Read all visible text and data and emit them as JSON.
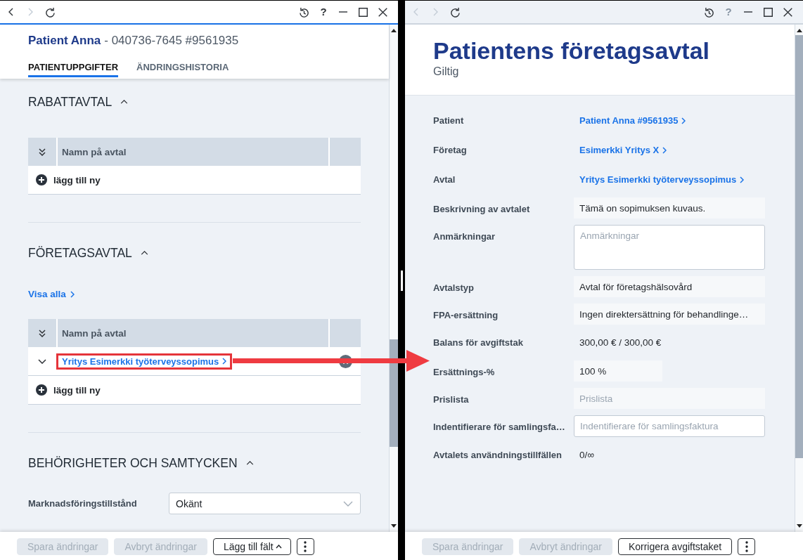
{
  "left_window": {
    "active": true,
    "toolbar": {
      "nav": [
        {
          "kind": "back",
          "disabled": false
        },
        {
          "kind": "forward",
          "disabled": true
        },
        {
          "kind": "reload",
          "disabled": false
        }
      ],
      "actions": [
        {
          "kind": "history",
          "disabled": false
        },
        {
          "kind": "help",
          "label": "?",
          "disabled": false
        },
        {
          "kind": "minimize",
          "disabled": false
        },
        {
          "kind": "maximize",
          "disabled": false
        },
        {
          "kind": "close",
          "disabled": false
        }
      ]
    },
    "header": {
      "name": "Patient Anna",
      "details": "- 040736-7645 #9561935"
    },
    "tabs": [
      {
        "label": "PATIENTUPPGIFTER",
        "selected": true
      },
      {
        "label": "ÄNDRINGSHISTORIA",
        "selected": false
      }
    ],
    "sections": [
      {
        "kind": "table",
        "title": "RABATTAVTAL",
        "expanded": true,
        "table": {
          "columns": [
            "Namn på avtal"
          ],
          "add_label": "lägg till ny"
        }
      },
      {
        "kind": "table",
        "title": "FÖRETAGSAVTAL",
        "expanded": true,
        "show_all": "Visa alla",
        "table": {
          "columns": [
            "Namn på avtal"
          ],
          "rows": [
            {
              "name": "Yritys Esimerkki työterveyssopimus",
              "expanded": false,
              "annotated": true
            }
          ],
          "add_label": "lägg till ny"
        }
      },
      {
        "kind": "fields",
        "title": "BEHÖRIGHETER OCH SAMTYCKEN",
        "expanded": true,
        "fields": [
          {
            "label": "Marknadsföringstillstånd",
            "kind": "select",
            "value": "Okänt"
          }
        ]
      }
    ],
    "footer_buttons": [
      {
        "kind": "button",
        "label": "Spara ändringar",
        "disabled": true
      },
      {
        "kind": "button",
        "label": "Avbryt ändringar",
        "disabled": true
      },
      {
        "kind": "dropdown",
        "label": "Lägg till fält",
        "disabled": false
      },
      {
        "kind": "more",
        "disabled": false
      }
    ]
  },
  "right_window": {
    "active": false,
    "toolbar": {
      "nav": [
        {
          "kind": "back",
          "disabled": true
        },
        {
          "kind": "forward",
          "disabled": true
        },
        {
          "kind": "reload",
          "disabled": false
        }
      ],
      "actions": [
        {
          "kind": "history",
          "disabled": false
        },
        {
          "kind": "help",
          "label": "?",
          "disabled": true
        },
        {
          "kind": "minimize",
          "disabled": false
        },
        {
          "kind": "maximize",
          "disabled": false
        },
        {
          "kind": "close",
          "disabled": false
        }
      ]
    },
    "title": "Patientens företagsavtal",
    "status": "Giltig",
    "fields": [
      {
        "label": "Patient",
        "kind": "link",
        "value": "Patient Anna #9561935"
      },
      {
        "label": "Företag",
        "kind": "link",
        "value": "Esimerkki Yritys X"
      },
      {
        "label": "Avtal",
        "kind": "link",
        "value": "Yritys Esimerkki työterveyssopimus"
      },
      {
        "label": "Beskrivning av avtalet",
        "kind": "readonly",
        "value": "Tämä on sopimuksen kuvaus."
      },
      {
        "label": "Anmärkningar",
        "kind": "textarea",
        "placeholder": "Anmärkningar"
      },
      {
        "label": "Avtalstyp",
        "kind": "readonly",
        "value": "Avtal för företagshälsovård"
      },
      {
        "label": "FPA-ersättning",
        "kind": "readonly",
        "value": "Ingen direktersättning för behandlinge…"
      },
      {
        "label": "Balans för avgiftstak",
        "kind": "text",
        "value": "300,00 € / 300,00 €"
      },
      {
        "label": "Ersättnings-%",
        "kind": "number",
        "value": "100 %"
      },
      {
        "label": "Prislista",
        "kind": "readonly",
        "placeholder": "Prislista"
      },
      {
        "label": "Indentifierare för samlingsfa…",
        "kind": "input",
        "placeholder": "Indentifierare för samlingsfaktura"
      },
      {
        "label": "Avtalets användningstillfällen",
        "kind": "text",
        "value": "0/∞"
      }
    ],
    "footer_buttons": [
      {
        "kind": "button",
        "label": "Spara ändringar",
        "disabled": true
      },
      {
        "kind": "button",
        "label": "Avbryt ändringar",
        "disabled": true
      },
      {
        "kind": "button",
        "label": "Korrigera avgiftstaket",
        "disabled": false
      },
      {
        "kind": "more",
        "disabled": false
      }
    ]
  }
}
